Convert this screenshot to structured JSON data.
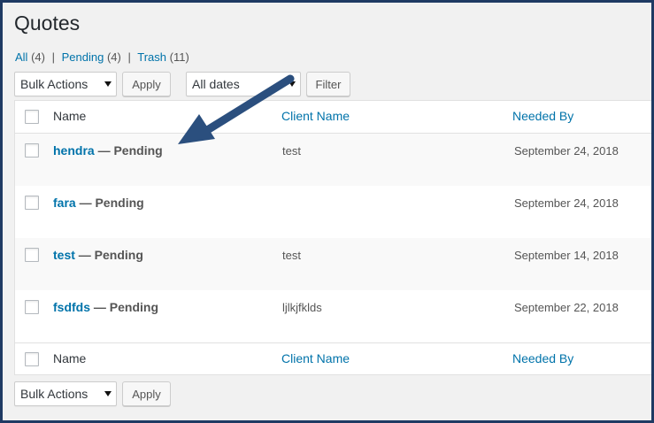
{
  "page": {
    "title": "Quotes"
  },
  "views": [
    {
      "label": "All",
      "count": "(4)"
    },
    {
      "label": "Pending",
      "count": "(4)"
    },
    {
      "label": "Trash",
      "count": "(11)"
    }
  ],
  "separator": "|",
  "top_nav": {
    "bulk_actions": "Bulk Actions",
    "apply": "Apply",
    "dates": "All dates",
    "filter": "Filter"
  },
  "bottom_nav": {
    "bulk_actions": "Bulk Actions",
    "apply": "Apply"
  },
  "columns": {
    "name": "Name",
    "client": "Client Name",
    "needed": "Needed By"
  },
  "status_sep": "— Pending",
  "rows": [
    {
      "title": "hendra",
      "client": "test",
      "needed": "September 24, 2018"
    },
    {
      "title": "fara",
      "client": "",
      "needed": "September 24, 2018"
    },
    {
      "title": "test",
      "client": "test",
      "needed": "September 14, 2018"
    },
    {
      "title": "fsdfds",
      "client": "ljlkjfklds",
      "needed": "September 22, 2018"
    }
  ],
  "colors": {
    "link": "#0073aa",
    "frame": "#1f3a63",
    "arrow": "#2b4f7e"
  }
}
